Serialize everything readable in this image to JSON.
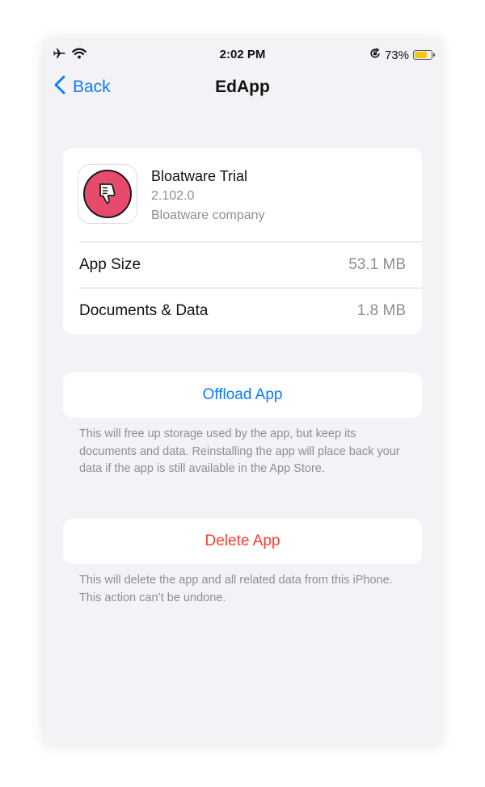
{
  "status_bar": {
    "time": "2:02 PM",
    "battery_percent": "73%",
    "battery_level": 0.73,
    "icons": [
      "airplane-icon",
      "wifi-icon",
      "orientation-lock-icon",
      "battery-icon"
    ]
  },
  "nav": {
    "back_label": "Back",
    "title": "EdApp"
  },
  "app_info": {
    "name": "Bloatware Trial",
    "version": "2.102.0",
    "company": "Bloatware company",
    "icon": "thumbs-down-icon"
  },
  "storage": [
    {
      "label": "App Size",
      "value": "53.1 MB"
    },
    {
      "label": "Documents & Data",
      "value": "1.8 MB"
    }
  ],
  "offload": {
    "label": "Offload App",
    "note": "This will free up storage used by the app, but keep its documents and data. Reinstalling the app will place back your data if the app is still available in the App Store."
  },
  "delete": {
    "label": "Delete App",
    "note": "This will delete the app and all related data from this iPhone. This action can’t be undone."
  },
  "colors": {
    "accent": "#0a7cff",
    "destructive": "#ff3b30",
    "background": "#f2f2f7",
    "app_icon": "#e84a6c",
    "battery": "#f5c518"
  }
}
